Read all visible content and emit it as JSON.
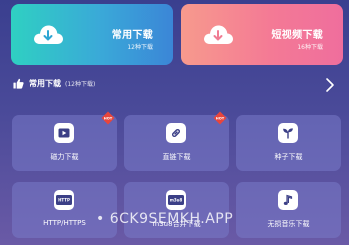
{
  "hero": {
    "left": {
      "title": "常用下载",
      "subtitle": "12种下载",
      "icon": "cloud-download-icon",
      "gradient": [
        "#2fd0c2",
        "#3b86d7"
      ]
    },
    "right": {
      "title": "短视频下载",
      "subtitle": "16种下载",
      "icon": "cloud-download-icon",
      "gradient": [
        "#f79a8d",
        "#ef6e9d"
      ]
    }
  },
  "section": {
    "title": "常用下载",
    "count": "(12种下载)",
    "icon": "thumbs-up-icon",
    "arrow_icon": "chevron-right-icon"
  },
  "tiles": [
    {
      "label": "磁力下载",
      "icon": "play-icon",
      "hot": true
    },
    {
      "label": "直链下载",
      "icon": "link-icon",
      "hot": true
    },
    {
      "label": "种子下载",
      "icon": "seedling-icon",
      "hot": false
    },
    {
      "label": "HTTP/HTTPS",
      "icon": "http-icon",
      "icon_text": "HTTP",
      "hot": false
    },
    {
      "label": "m3u8合并下载",
      "icon": "m3u8-icon",
      "icon_text": "m3u8",
      "hot": false
    },
    {
      "label": "无损音乐下载",
      "icon": "music-note-icon",
      "hot": false
    }
  ],
  "hot_badge_text": "HOT",
  "watermark": "• 6CK9SEMKH.APP",
  "colors": {
    "background_top": "#3a3f8f",
    "background_bottom": "#6a5aa6",
    "tile_bg": "#7a7cc8",
    "hot_badge": "#e8453c"
  }
}
